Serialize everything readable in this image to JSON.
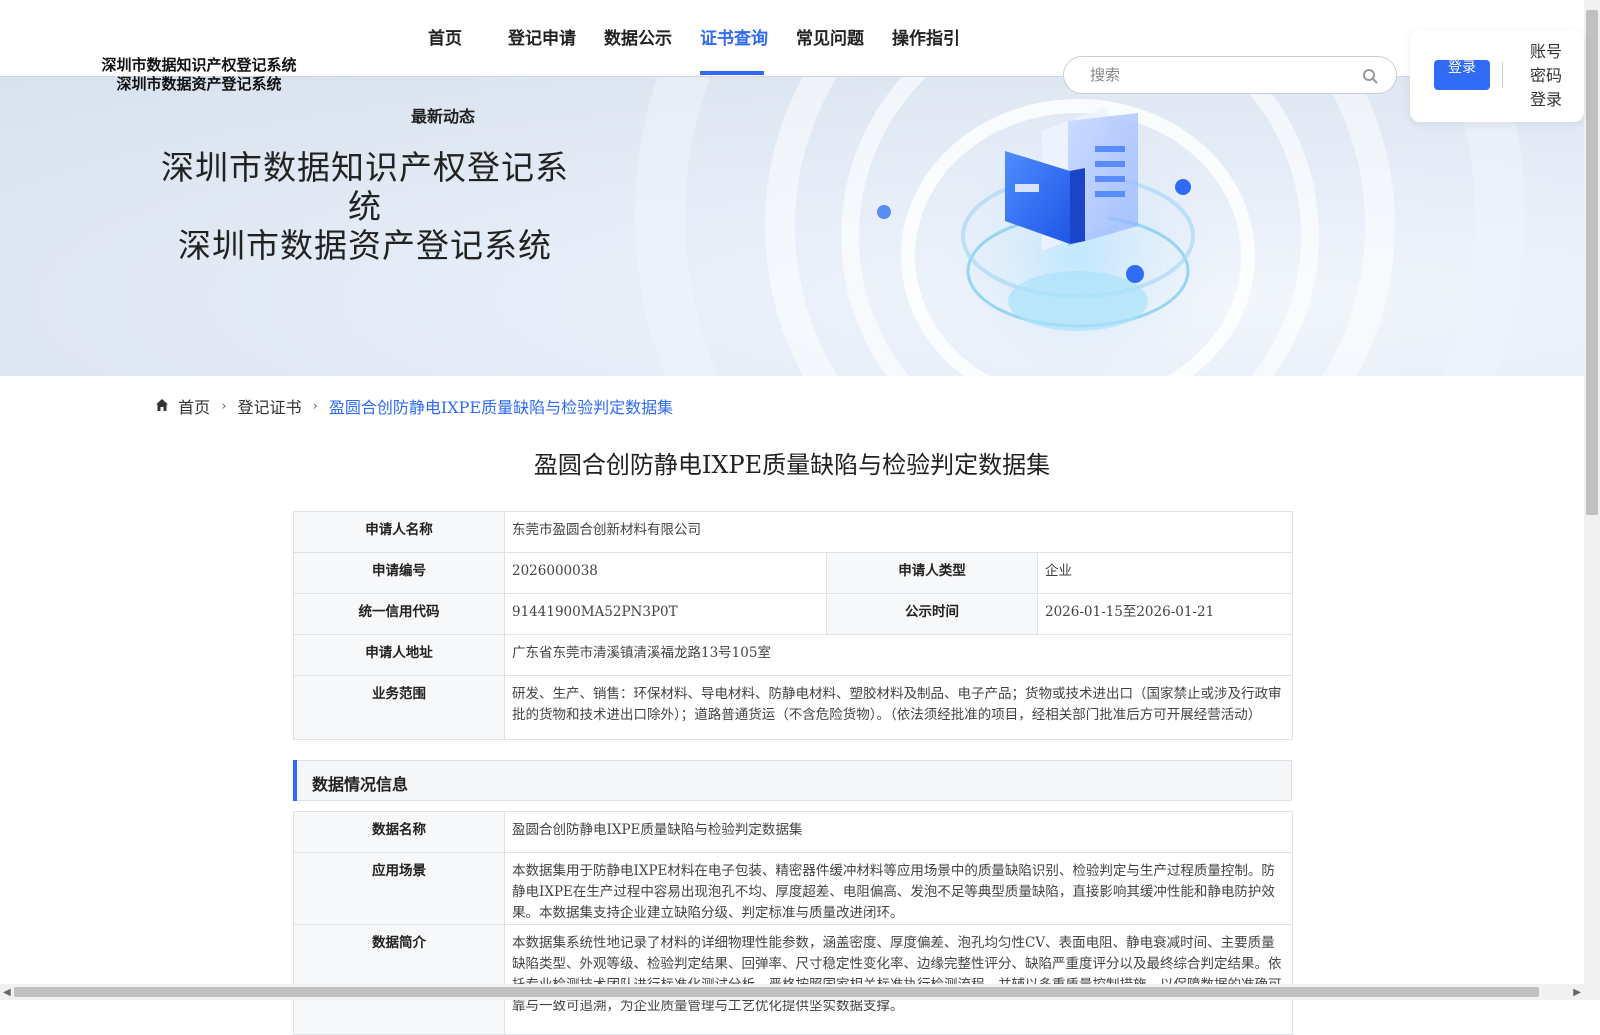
{
  "site": {
    "title_line1": "深圳市数据知识产权登记系统",
    "title_line2": "深圳市数据资产登记系统"
  },
  "nav": {
    "items": [
      {
        "label": "首页"
      },
      {
        "label": "登记申请"
      },
      {
        "label": "数据公示"
      },
      {
        "label": "证书查询"
      },
      {
        "label": "常见问题"
      },
      {
        "label": "操作指引"
      }
    ],
    "active": "证书查询",
    "sub_item": "最新动态"
  },
  "search": {
    "placeholder": "搜索",
    "value": ""
  },
  "login": {
    "button_label": "登录",
    "alt_label": "账号密码登录"
  },
  "banner": {
    "title_line1": "深圳市数据知识产权登记系统",
    "title_line2": "深圳市数据资产登记系统"
  },
  "breadcrumb": {
    "home": "首页",
    "section": "登记证书",
    "current": "盈圆合创防静电IXPE质量缺陷与检验判定数据集"
  },
  "page_title": "盈圆合创防静电IXPE质量缺陷与检验判定数据集",
  "applicant": {
    "name_label": "申请人名称",
    "name_value": "东莞市盈圆合创新材料有限公司",
    "app_no_label": "申请编号",
    "app_no_value": "2026000038",
    "type_label": "申请人类型",
    "type_value": "企业",
    "credit_label": "统一信用代码",
    "credit_value": "91441900MA52PN3P0T",
    "public_label": "公示时间",
    "public_value": "2026-01-15至2026-01-21",
    "address_label": "申请人地址",
    "address_value": "广东省东莞市清溪镇清溪福龙路13号105室",
    "scope_label": "业务范围",
    "scope_value": "研发、生产、销售：环保材料、导电材料、防静电材料、塑胶材料及制品、电子产品；货物或技术进出口（国家禁止或涉及行政审批的货物和技术进出口除外）；道路普通货运（不含危险货物）。（依法须经批准的项目，经相关部门批准后方可开展经营活动）"
  },
  "data_section": {
    "heading": "数据情况信息",
    "name_label": "数据名称",
    "name_value": "盈圆合创防静电IXPE质量缺陷与检验判定数据集",
    "scene_label": "应用场景",
    "scene_value": "本数据集用于防静电IXPE材料在电子包装、精密器件缓冲材料等应用场景中的质量缺陷识别、检验判定与生产过程质量控制。防静电IXPE在生产过程中容易出现泡孔不均、厚度超差、电阻偏高、发泡不足等典型质量缺陷，直接影响其缓冲性能和静电防护效果。本数据集支持企业建立缺陷分级、判定标准与质量改进闭环。",
    "intro_label": "数据简介",
    "intro_value": "本数据集系统性地记录了材料的详细物理性能参数，涵盖密度、厚度偏差、泡孔均匀性CV、表面电阻、静电衰减时间、主要质量缺陷类型、外观等级、检验判定结果、回弹率、尺寸稳定性变化率、边缘完整性评分、缺陷严重度评分以及最终综合判定结果。依托专业检测技术团队进行标准化测试分析，严格按照国家相关标准执行检测流程，并辅以多重质量控制措施，以保障数据的准确可靠与一致可追溯，为企业质量管理与工艺优化提供坚实数据支撑。"
  },
  "colors": {
    "accent": "#2f6bf5"
  }
}
